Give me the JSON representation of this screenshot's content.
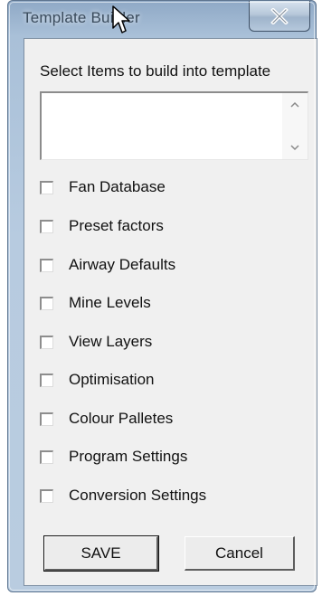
{
  "window": {
    "title": "Template Builder",
    "title_visible": "Template Builder",
    "close_glyph": "x"
  },
  "main": {
    "instruction": "Select Items to build into template",
    "items": [
      {
        "label": "Fan Database",
        "checked": false
      },
      {
        "label": "Preset factors",
        "checked": false
      },
      {
        "label": "Airway Defaults",
        "checked": false
      },
      {
        "label": "Mine Levels",
        "checked": false
      },
      {
        "label": "View Layers",
        "checked": false
      },
      {
        "label": "Optimisation",
        "checked": false
      },
      {
        "label": "Colour Palletes",
        "checked": false
      },
      {
        "label": "Program Settings",
        "checked": false
      },
      {
        "label": "Conversion Settings",
        "checked": false
      }
    ]
  },
  "buttons": {
    "save_label": "SAVE",
    "cancel_label": "Cancel"
  },
  "icons": {
    "close": "close-icon",
    "scroll_up": "scroll-up-arrow-icon",
    "scroll_down": "scroll-down-arrow-icon",
    "cursor": "mouse-cursor-icon"
  },
  "colors": {
    "frame": "#b7cbe0",
    "client_bg": "#f0f0f0",
    "text": "#111111"
  }
}
